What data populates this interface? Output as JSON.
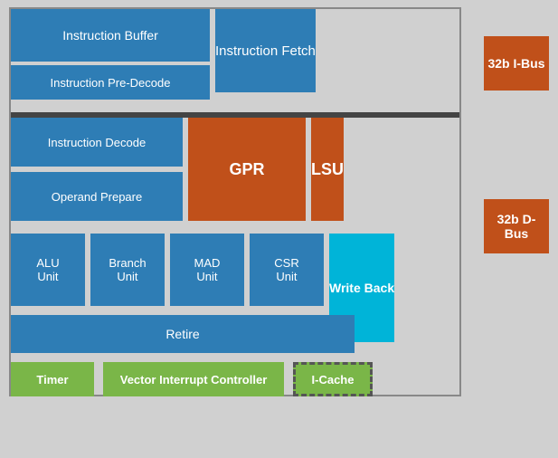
{
  "blocks": {
    "instruction_buffer": "Instruction Buffer",
    "instruction_fetch": "Instruction Fetch",
    "instruction_predecode": "Instruction Pre-Decode",
    "instruction_decode": "Instruction Decode",
    "operand_prepare": "Operand Prepare",
    "gpr": "GPR",
    "lsu": "LSU",
    "alu_unit": "ALU\nUnit",
    "branch_unit": "Branch\nUnit",
    "mad_unit": "MAD\nUnit",
    "csr_unit": "CSR\nUnit",
    "write_back": "Write\nBack",
    "retire": "Retire",
    "timer": "Timer",
    "vic": "Vector Interrupt Controller",
    "icache": "I-Cache",
    "bus_i": "32b\nI-Bus",
    "bus_d": "32b D-\nBus"
  },
  "colors": {
    "blue": "#2e7db5",
    "orange": "#c0501a",
    "cyan": "#00b4d8",
    "green": "#7ab648",
    "bg": "#d0d0d0"
  }
}
